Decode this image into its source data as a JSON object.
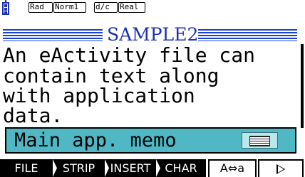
{
  "status": {
    "battery_icon": "battery-icon",
    "angle": "Rad",
    "display": "Norm1",
    "fraction": "d/c",
    "complex": "Real"
  },
  "title": "SAMPLE2",
  "body_lines": [
    "An eActivity file can",
    "contain text along",
    "with application",
    "data."
  ],
  "strip": {
    "label": "Main app. memo",
    "icon": "memo-icon"
  },
  "function_keys": [
    "FILE",
    "STRIP",
    "INSERT",
    "CHAR",
    "A⇔a",
    "▷"
  ],
  "colors": {
    "title": "#1a2fb6",
    "title_rule": "#1c44c9",
    "strip": "#4fb8c4"
  }
}
